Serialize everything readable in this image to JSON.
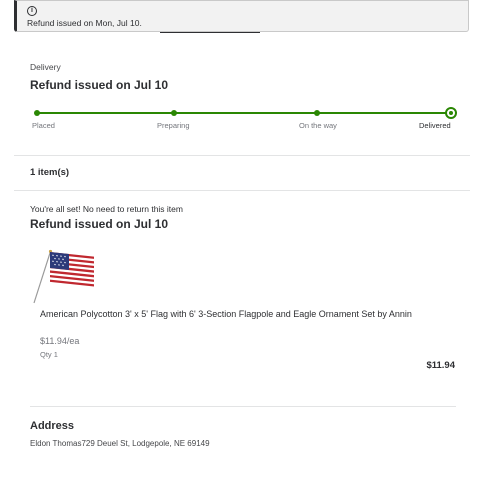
{
  "banner": {
    "message": "Refund issued on Mon, Jul 10."
  },
  "delivery": {
    "label": "Delivery",
    "status_title": "Refund issued on Jul 10",
    "steps": [
      "Placed",
      "Preparing",
      "On the way",
      "Delivered"
    ]
  },
  "items_count": "1 item(s)",
  "return_note": "You're all set! No need to return this item",
  "item_status_title": "Refund issued on Jul 10",
  "product": {
    "title": "American Polycotton 3' x 5' Flag with 6' 3-Section Flagpole and Eagle Ornament Set by Annin",
    "unit_price": "$11.94/ea",
    "qty": "Qty 1",
    "total": "$11.94"
  },
  "address": {
    "title": "Address",
    "line": "Eldon Thomas729 Deuel St, Lodgepole, NE 69149"
  },
  "colors": {
    "progress": "#2a8703",
    "text": "#2e2f32",
    "muted": "#74767c"
  }
}
